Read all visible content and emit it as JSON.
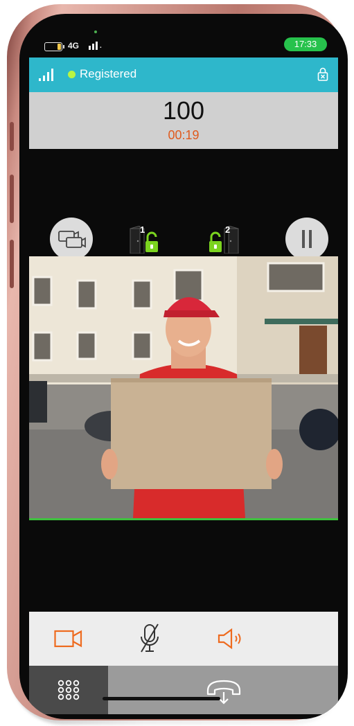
{
  "status_bar": {
    "network": "4G",
    "time": "17:33"
  },
  "header": {
    "registration_status": "Registered"
  },
  "call": {
    "number": "100",
    "duration": "00:19"
  },
  "doors": [
    {
      "label": "1"
    },
    {
      "label": "2"
    }
  ],
  "colors": {
    "registered_bar": "#2eb7cb",
    "time_pill": "#27c24c",
    "duration_text": "#e05a1c",
    "accent_orange": "#ee6a1e",
    "unlock_green": "#7bd31f"
  },
  "icons": {
    "camera_switch": "camera-switch-icon",
    "door_1": "door-unlock-icon",
    "door_2": "door-unlock-icon",
    "pause": "pause-icon",
    "video": "video-camera-icon",
    "mute": "microphone-off-icon",
    "speaker": "speaker-icon",
    "keypad": "keypad-icon",
    "hangup": "hangup-icon",
    "lock": "lock-icon"
  }
}
